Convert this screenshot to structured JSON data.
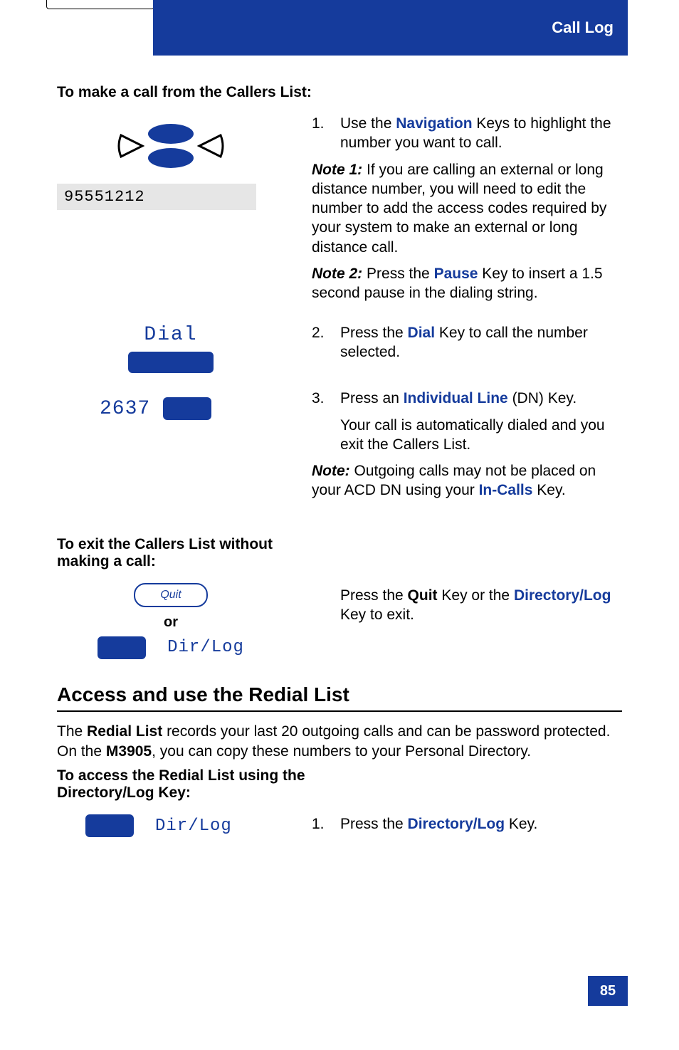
{
  "header": {
    "title": "Call Log"
  },
  "sec1": {
    "heading": "To make a call from the Callers List:",
    "lcd_number": "95551212",
    "step1_num": "1.",
    "step1_a": "Use the ",
    "step1_b": "Navigation",
    "step1_c": " Keys to highlight the number you want to call.",
    "note1_label": "Note 1:",
    "note1_text": "   If you are calling an external or long distance number, you will need to edit the number to add the access codes required by your system to make an external or long distance call.",
    "note2_label": "Note 2:",
    "note2_a": "   Press the ",
    "note2_b": "Pause",
    "note2_c": " Key to insert a 1.5 second pause in the dialing string.",
    "softkey_dial": "Dial",
    "step2_num": "2.",
    "step2_a": "Press the ",
    "step2_b": "Dial",
    "step2_c": " Key to call the number selected.",
    "line_dn": "2637",
    "step3_num": "3.",
    "step3_a": "Press an ",
    "step3_b": "Individual Line",
    "step3_c": " (DN) Key.",
    "step3_sub": "Your call is automatically dialed and you exit the Callers List.",
    "note3_label": "Note:",
    "note3_a": " Outgoing calls may not be placed on your ACD DN using your ",
    "note3_b": "In-Calls",
    "note3_c": " Key."
  },
  "sec2": {
    "heading": "To exit the Callers List without making a call:",
    "quit_label": "Quit",
    "or": "or",
    "dirlog_label": "Dir/Log",
    "right_a": "Press the ",
    "right_b": "Quit",
    "right_c": " Key or the ",
    "right_d": "Directory/Log",
    "right_e": " Key to exit."
  },
  "sec3": {
    "heading": "Access and use the Redial List",
    "p_a": "The ",
    "p_b": "Redial List",
    "p_c": " records your last 20 outgoing calls and can be password protected. On the ",
    "p_d": "M3905",
    "p_e": ", you can copy these numbers to your Personal Directory.",
    "sub_heading": "To access the Redial List using the Directory/Log Key:",
    "dirlog_label": "Dir/Log",
    "step1_num": "1.",
    "step1_a": "Press the ",
    "step1_b": "Directory/Log",
    "step1_c": " Key."
  },
  "page_number": "85"
}
